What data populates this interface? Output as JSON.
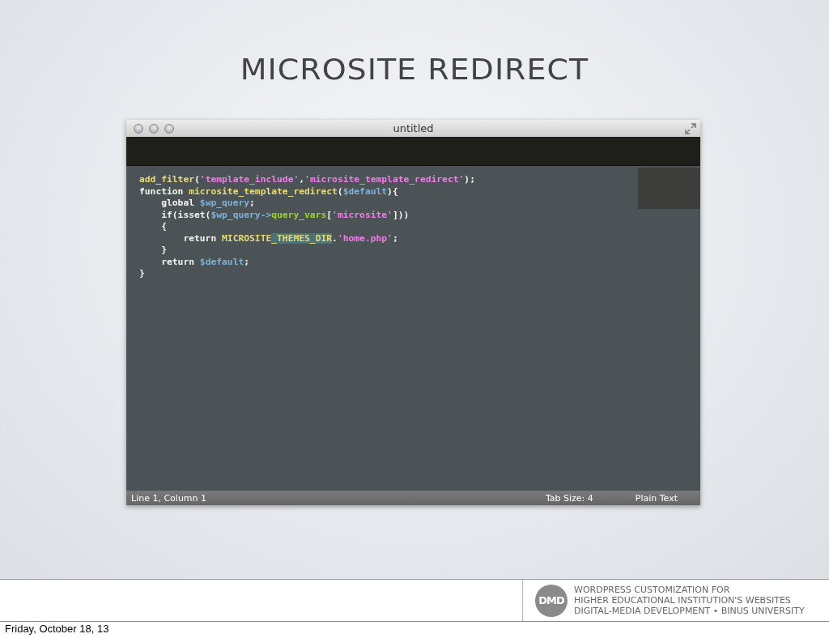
{
  "slide": {
    "title": "MICROSITE REDIRECT"
  },
  "window": {
    "title": "untitled"
  },
  "editor": {
    "lines": [
      [
        {
          "text": "add_filter",
          "kind": "fn"
        },
        {
          "text": "(",
          "kind": "punc"
        },
        {
          "text": "'template_include'",
          "kind": "str"
        },
        {
          "text": ",",
          "kind": "punc"
        },
        {
          "text": "'microsite_template_redirect'",
          "kind": "str"
        },
        {
          "text": ");",
          "kind": "punc"
        }
      ],
      [
        {
          "text": "function ",
          "kind": "kw"
        },
        {
          "text": "microsite_template_redirect",
          "kind": "fn"
        },
        {
          "text": "(",
          "kind": "punc"
        },
        {
          "text": "$default",
          "kind": "var"
        },
        {
          "text": "){",
          "kind": "punc"
        }
      ],
      [
        {
          "text": "    global ",
          "kind": "kw"
        },
        {
          "text": "$wp_query",
          "kind": "var"
        },
        {
          "text": ";",
          "kind": "punc"
        }
      ],
      [
        {
          "text": "    if(isset(",
          "kind": "kw"
        },
        {
          "text": "$wp_query->",
          "kind": "var"
        },
        {
          "text": "query_vars",
          "kind": "prop"
        },
        {
          "text": "[",
          "kind": "punc"
        },
        {
          "text": "'microsite'",
          "kind": "str"
        },
        {
          "text": "]))",
          "kind": "punc"
        }
      ],
      [
        {
          "text": "    {",
          "kind": "punc"
        }
      ],
      [
        {
          "text": "        return ",
          "kind": "kw"
        },
        {
          "text": "MICROSITE",
          "kind": "fn"
        },
        {
          "text": "_THEMES_DIR",
          "kind": "selection"
        },
        {
          "text": ".",
          "kind": "punc"
        },
        {
          "text": "'home.php'",
          "kind": "str"
        },
        {
          "text": ";",
          "kind": "punc"
        }
      ],
      [
        {
          "text": "    }",
          "kind": "punc"
        }
      ],
      [
        {
          "text": "    return ",
          "kind": "kw"
        },
        {
          "text": "$default",
          "kind": "var"
        },
        {
          "text": ";",
          "kind": "punc"
        }
      ],
      [
        {
          "text": "}",
          "kind": "punc"
        }
      ]
    ]
  },
  "status_bar": {
    "position": "Line 1, Column 1",
    "tab_size": "Tab Size: 4",
    "syntax": "Plain Text"
  },
  "footer": {
    "logo": "DMD",
    "lines": [
      "WORDPRESS CUSTOMIZATION FOR",
      "HIGHER EDUCATIONAL INSTITUTION'S WEBSITES",
      "DIGITAL-MEDIA DEVELOPMENT • BINUS UNIVERSITY"
    ],
    "date": "Friday, October 18, 13"
  }
}
